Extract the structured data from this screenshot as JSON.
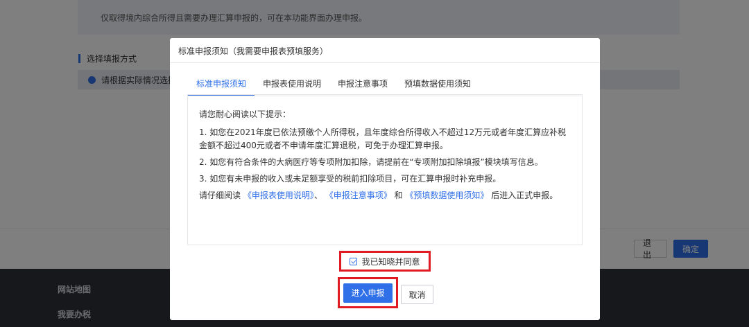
{
  "background": {
    "notice": "仅取得境内综合所得且需要办理汇算申报的，可在本功能界面办理申报。",
    "section_title": "选择填报方式",
    "option_label": "请根据实际情况选择",
    "exit_label": "退出",
    "confirm_label": "确定",
    "footer": [
      "网站地图",
      "我要办税"
    ]
  },
  "modal": {
    "title": "标准申报须知（我需要申报表预填服务）",
    "tabs": [
      {
        "label": "标准申报须知",
        "active": true
      },
      {
        "label": "申报表使用说明",
        "active": false
      },
      {
        "label": "申报注意事项",
        "active": false
      },
      {
        "label": "预填数据使用须知",
        "active": false
      }
    ],
    "content": {
      "lead": "请您耐心阅读以下提示：",
      "items": [
        "1. 如您在2021年度已依法预缴个人所得税，且年度综合所得收入不超过12万元或者年度汇算应补税金额不超过400元或者不申请年度汇算退税，可免于办理汇算申报。",
        "2. 如您有符合条件的大病医疗等专项附加扣除，请提前在“专项附加扣除填报”模块填写信息。",
        "3. 如您有未申报的收入或未足额享受的税前扣除项目，可在汇算申报时补充申报。"
      ],
      "final": {
        "prefix": "请仔细阅读",
        "link1": "《申报表使用说明》",
        "sep": "、",
        "link2": "《申报注意事项》",
        "and": "和",
        "link3": "《预填数据使用须知》",
        "suffix": "后进入正式申报。"
      }
    },
    "agree_label": "我已知晓并同意",
    "agree_checked": true,
    "enter_label": "进入申报",
    "cancel_label": "取消"
  },
  "colors": {
    "accent": "#2f6fe8",
    "highlight_border": "#e01b24",
    "footer_bg": "#2c3039"
  }
}
